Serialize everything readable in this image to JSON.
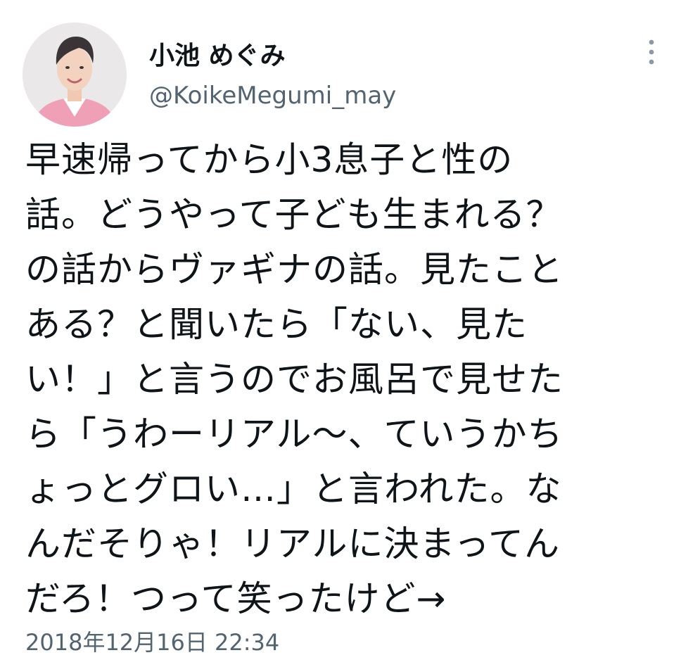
{
  "author": {
    "display_name": "小池 めぐみ",
    "handle": "@KoikeMegumi_may"
  },
  "tweet": {
    "lines": [
      "早速帰ってから小3息子と性の",
      "話。どうやって子ども生まれる？",
      "の話からヴァギナの話。見たこと",
      "ある？と聞いたら「ない、見た",
      "い！」と言うのでお風呂で見せた",
      "ら「うわーリアル〜、ていうかち",
      "ょっとグロい…」と言われた。な",
      "んだそりゃ！リアルに決まってん",
      "だろ！つって笑ったけど→"
    ],
    "timestamp": "2018年12月16日 22:34"
  },
  "icons": {
    "more": "more-vertical-icon",
    "avatar": "profile-photo"
  },
  "colors": {
    "text_primary": "#0f1419",
    "text_secondary": "#536471",
    "background": "#ffffff"
  }
}
